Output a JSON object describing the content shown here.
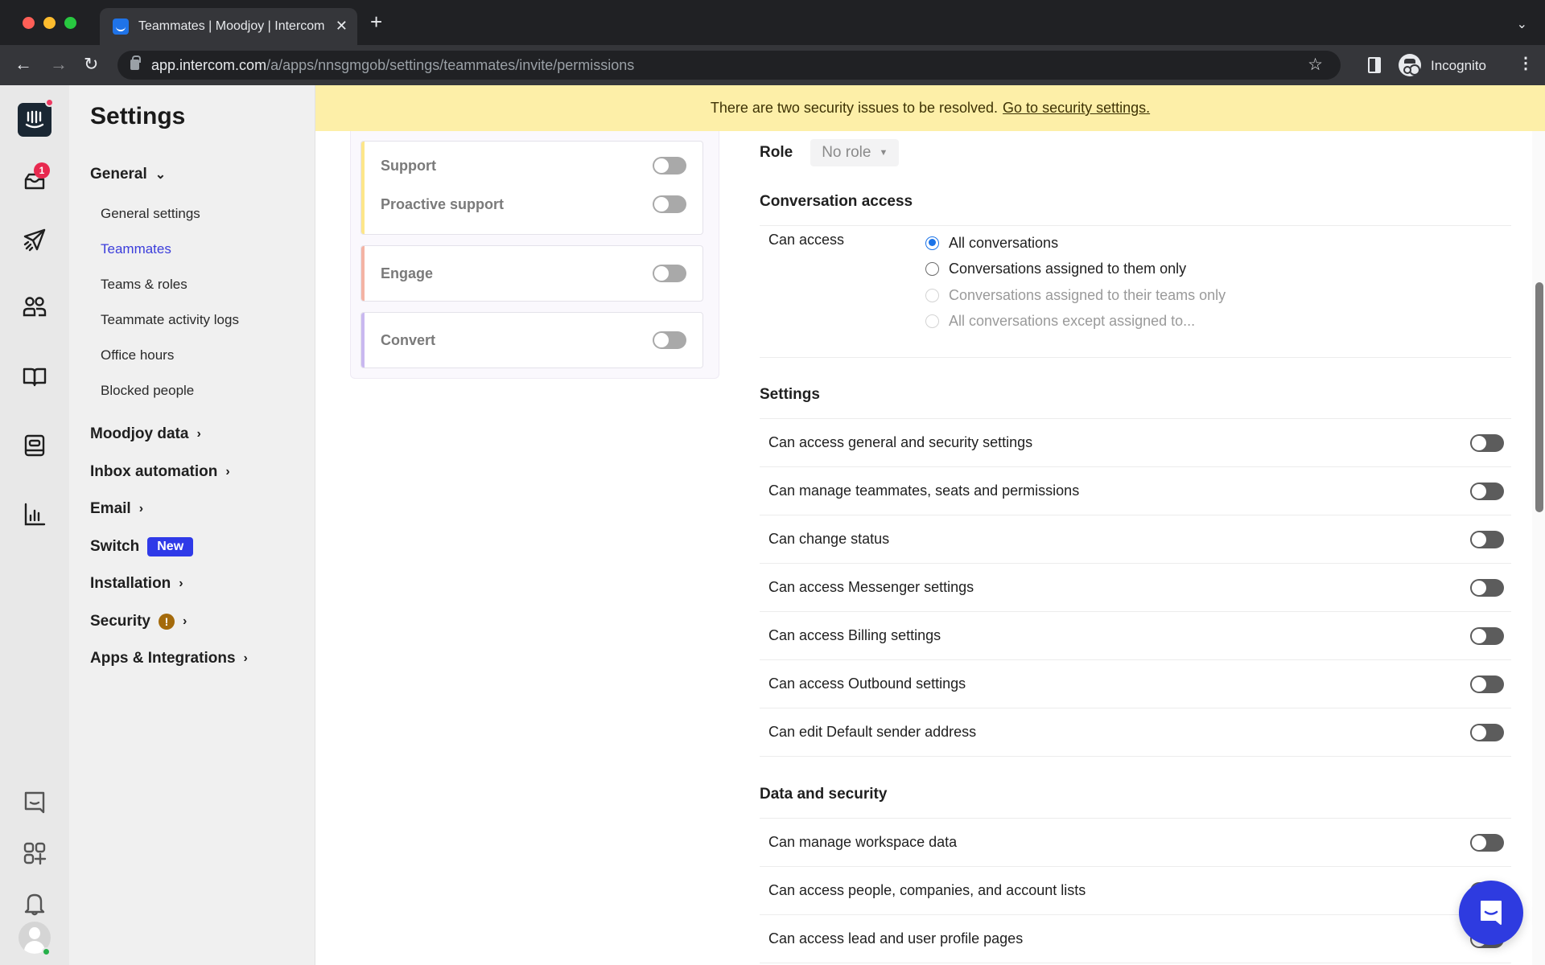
{
  "browser": {
    "tab_title": "Teammates | Moodjoy | Intercom",
    "url_host": "app.intercom.com",
    "url_path": "/a/apps/nnsgmgob/settings/teammates/invite/permissions",
    "profile_label": "Incognito"
  },
  "rail": {
    "inbox_badge": "1",
    "icons": [
      "intercom-logo",
      "inbox-icon",
      "outbound-icon",
      "contacts-icon",
      "articles-icon",
      "help-desk-icon",
      "reports-icon",
      "messenger-icon",
      "apps-icon",
      "notifications-icon",
      "avatar"
    ]
  },
  "nav": {
    "title": "Settings",
    "general": {
      "label": "General",
      "items": [
        "General settings",
        "Teammates",
        "Teams & roles",
        "Teammate activity logs",
        "Office hours",
        "Blocked people"
      ],
      "active": "Teammates"
    },
    "groups": [
      {
        "label": "Moodjoy data"
      },
      {
        "label": "Inbox automation"
      },
      {
        "label": "Email"
      },
      {
        "label": "Switch",
        "badge": "New"
      },
      {
        "label": "Installation"
      },
      {
        "label": "Security",
        "warning": "!"
      },
      {
        "label": "Apps & Integrations"
      }
    ]
  },
  "banner": {
    "text": "There are two security issues to be resolved.",
    "link": "Go to security settings."
  },
  "products": {
    "cards": [
      {
        "accent": "#fde68a",
        "rows": [
          {
            "label": "Support",
            "enabled": false
          },
          {
            "label": "Proactive support",
            "enabled": false
          }
        ]
      },
      {
        "accent": "#f4b3a4",
        "rows": [
          {
            "label": "Engage",
            "enabled": false
          }
        ]
      },
      {
        "accent": "#c9b8f0",
        "rows": [
          {
            "label": "Convert",
            "enabled": false
          }
        ]
      }
    ]
  },
  "permissions": {
    "role_label": "Role",
    "role_value": "No role",
    "conversation_access": {
      "title": "Conversation access",
      "label": "Can access",
      "options": [
        {
          "label": "All conversations",
          "checked": true,
          "disabled": false
        },
        {
          "label": "Conversations assigned to them only",
          "checked": false,
          "disabled": false
        },
        {
          "label": "Conversations assigned to their teams only",
          "checked": false,
          "disabled": true
        },
        {
          "label": "All conversations except assigned to...",
          "checked": false,
          "disabled": true
        }
      ]
    },
    "settings": {
      "title": "Settings",
      "items": [
        {
          "label": "Can access general and security settings",
          "enabled": false
        },
        {
          "label": "Can manage teammates, seats and permissions",
          "enabled": false
        },
        {
          "label": "Can change status",
          "enabled": false
        },
        {
          "label": "Can access Messenger settings",
          "enabled": false
        },
        {
          "label": "Can access Billing settings",
          "enabled": false
        },
        {
          "label": "Can access Outbound settings",
          "enabled": false
        },
        {
          "label": "Can edit Default sender address",
          "enabled": false
        }
      ]
    },
    "data_security": {
      "title": "Data and security",
      "items": [
        {
          "label": "Can manage workspace data",
          "enabled": false
        },
        {
          "label": "Can access people, companies, and account lists",
          "enabled": false
        },
        {
          "label": "Can access lead and user profile pages",
          "enabled": false
        }
      ]
    }
  },
  "colors": {
    "brand": "#2e3be0",
    "active_nav": "#3b3ddb",
    "banner_bg": "#fdefa8",
    "warning": "#a46a0b",
    "badge": "#e8294f"
  }
}
